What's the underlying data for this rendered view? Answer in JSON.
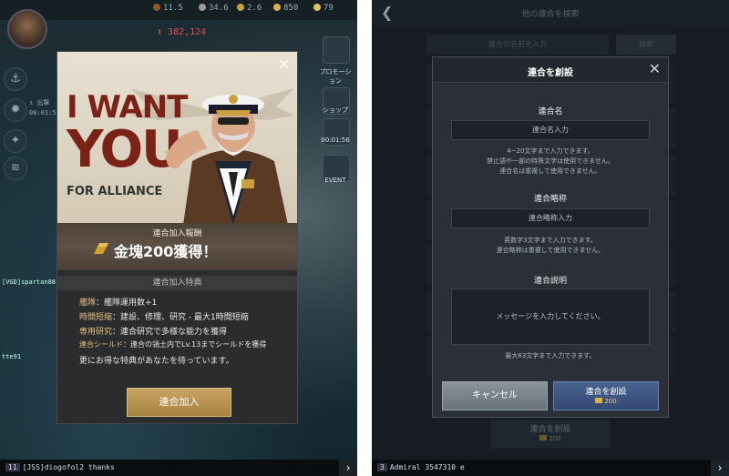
{
  "left": {
    "resources": [
      "11.5",
      "34.6",
      "2.6",
      "850",
      "79"
    ],
    "power": "382,124",
    "side_labels": {
      "promo": "プロモーション",
      "shop": "ショップ",
      "timer": "00:01:56",
      "event": "EVENT",
      "player": "[VGD]spartan88",
      "player2": "tte91",
      "clock": "00:01:5"
    },
    "chat": {
      "channel": "11",
      "text": "[JSS]diogofol2 thanks"
    },
    "modal": {
      "poster_line1": "I WANT",
      "poster_line2": "YOU",
      "poster_line3": "FOR ALLIANCE",
      "reward_title": "連合加入報酬",
      "reward_main": "金塊200獲得！",
      "bonus_head": "連合加入特典",
      "bonuses": [
        {
          "key": "艦隊",
          "value": "：艦隊運用数+1"
        },
        {
          "key": "時間短縮",
          "value": "：建設、修理、研究 - 最大1時間短縮"
        },
        {
          "key": "専用研究",
          "value": "：連合研究で多様な能力を獲得"
        },
        {
          "key": "連合シールド",
          "value": "：連合の領土内でLv.13までシールドを獲得"
        }
      ],
      "more": "更にお得な特典があなたを待っています。",
      "join_label": "連合加入"
    }
  },
  "right": {
    "header_title": "他の連合を検索",
    "bg_search_placeholder": "連合の名前を入力",
    "bg_search_btn": "検索",
    "bg_create": "連合を創設",
    "bg_create_cost": "200",
    "chat": {
      "channel": "3",
      "text": "Admiral 3547310 e"
    },
    "modal": {
      "title": "連合を創設",
      "name_label": "連合名",
      "name_placeholder": "連合名入力",
      "name_hint1": "4~20文字まで入力できます。",
      "name_hint2": "禁止語や一部の特殊文字は使用できません。",
      "name_hint3": "連合名は重複して使用できません。",
      "abbr_label": "連合略称",
      "abbr_placeholder": "連合略称入力",
      "abbr_hint1": "英数字3文字まで入力できます。",
      "abbr_hint2": "連合略称は重複して使用できません。",
      "desc_label": "連合説明",
      "desc_placeholder": "メッセージを入力してください。",
      "desc_hint": "最大63文字まで入力できます。",
      "cancel_label": "キャンセル",
      "create_label": "連合を創設",
      "create_cost": "200"
    }
  }
}
